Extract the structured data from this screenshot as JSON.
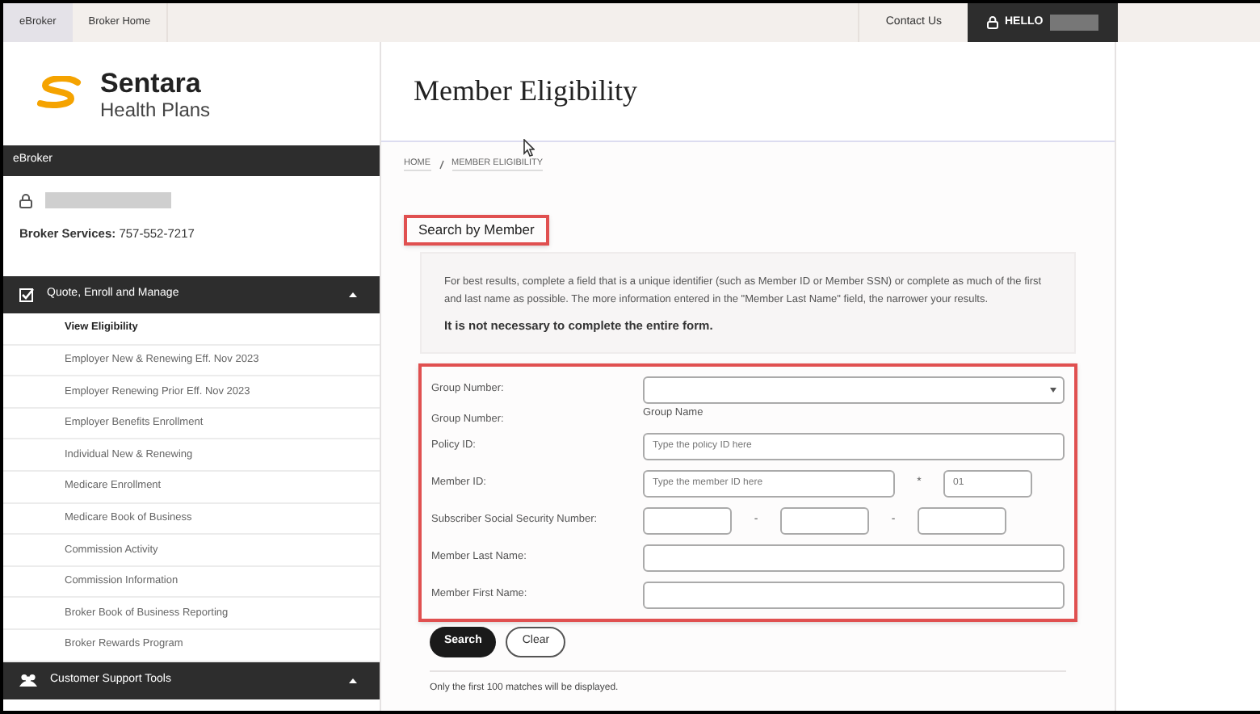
{
  "top_nav": {
    "tabs": [
      {
        "label": "eBroker",
        "selected": true
      },
      {
        "label": "Broker Home",
        "selected": false
      }
    ],
    "contact": "Contact Us",
    "greeting": "HELLO"
  },
  "sidebar": {
    "logo": {
      "name": "Sentara",
      "subtitle": "Health Plans"
    },
    "header": "eBroker",
    "broker_services": {
      "label": "Broker Services:",
      "phone": "757-552-7217"
    },
    "sections": [
      {
        "title": "Quote, Enroll and Manage",
        "kind": "check",
        "expanded": true,
        "items": [
          {
            "label": "View Eligibility",
            "selected": true
          },
          {
            "label": "Employer New & Renewing Eff. Nov 2023",
            "selected": false
          },
          {
            "label": "Employer Renewing Prior Eff. Nov 2023",
            "selected": false
          },
          {
            "label": "Employer Benefits Enrollment",
            "selected": false
          },
          {
            "label": "Individual New & Renewing",
            "selected": false
          },
          {
            "label": "Medicare Enrollment",
            "selected": false
          },
          {
            "label": "Medicare Book of Business",
            "selected": false
          },
          {
            "label": "Commission Activity",
            "selected": false
          },
          {
            "label": "Commission Information",
            "selected": false
          },
          {
            "label": "Broker Book of Business Reporting",
            "selected": false
          },
          {
            "label": "Broker Rewards Program",
            "selected": false
          }
        ]
      },
      {
        "title": "Customer Support Tools",
        "kind": "people",
        "expanded": true
      }
    ]
  },
  "main": {
    "title": "Member Eligibility",
    "breadcrumb": [
      "HOME",
      "MEMBER ELIGIBILITY"
    ],
    "section_title": "Search by Member",
    "info": {
      "text": "For best results, complete a field that is a unique identifier (such as Member ID or Member SSN) or complete as much of the first and last name as possible. The more information entered in the \"Member Last Name\" field, the narrower your results.",
      "note": "It is not necessary to complete the entire form."
    },
    "fields": [
      {
        "kind": "select",
        "label": "Group Number:"
      },
      {
        "kind": "info",
        "label": "Group Number:",
        "value": "Group Name"
      },
      {
        "kind": "text",
        "label": "Policy ID:",
        "placeholder": "Type the policy ID here"
      },
      {
        "kind": "member_id",
        "label": "Member ID:",
        "placeholder": "Type the member ID here",
        "separator": "*",
        "suffix_placeholder": "01"
      },
      {
        "kind": "ssn",
        "label": "Subscriber Social Security Number:",
        "separators": [
          "-",
          "-"
        ]
      },
      {
        "kind": "text",
        "label": "Member Last Name:"
      },
      {
        "kind": "text",
        "label": "Member First Name:"
      }
    ],
    "buttons": [
      {
        "label": "Search",
        "kind": "primary"
      },
      {
        "label": "Clear",
        "kind": "secondary"
      }
    ],
    "footer_note": "Only the first 100 matches will be displayed."
  }
}
